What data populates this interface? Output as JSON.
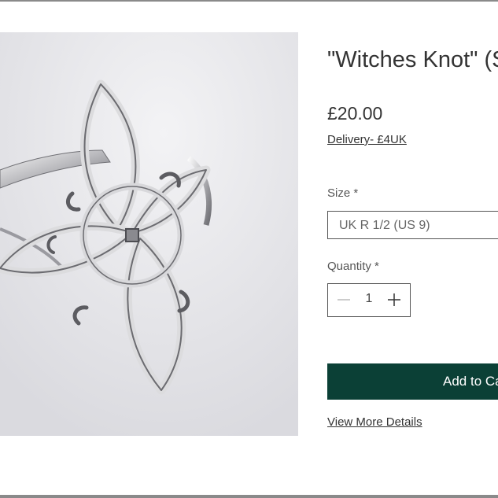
{
  "product": {
    "title": "\"Witches Knot\" (S",
    "price": "£20.00",
    "delivery_link": "Delivery- £4UK",
    "size_label": "Size *",
    "size_selected": "UK R 1/2 (US 9)",
    "quantity_label": "Quantity *",
    "quantity_value": "1",
    "add_to_cart_label": "Add to Cart",
    "view_more_details": "View More Details"
  },
  "icons": {
    "minus": "minus-icon",
    "plus": "plus-icon"
  },
  "colors": {
    "button_bg": "#0b4036",
    "text": "#333333",
    "border": "#555555"
  }
}
